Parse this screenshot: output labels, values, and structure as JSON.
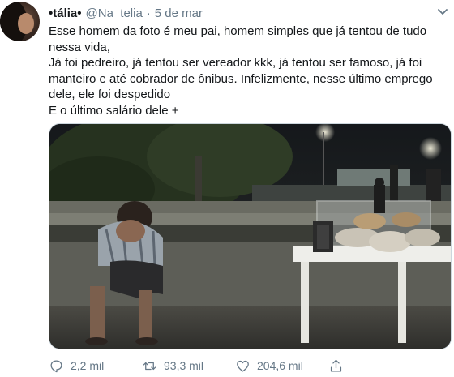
{
  "tweet": {
    "display_name": "•tália•",
    "handle": "@Na_telia",
    "separator": "·",
    "date": "5 de mar",
    "text": "Esse homem da foto é meu pai, homem simples que já tentou de tudo nessa vida,\nJá foi pedreiro, já tentou ser vereador kkk, já tentou ser famoso, já foi manteiro e até cobrador de ônibus. Infelizmente, nesse último emprego dele, ele foi despedido\nE o último salário dele +"
  },
  "actions": {
    "reply_count": "2,2 mil",
    "retweet_count": "93,3 mil",
    "like_count": "204,6 mil"
  },
  "icons": {
    "caret": "chevron-down-icon",
    "reply": "reply-icon",
    "retweet": "retweet-icon",
    "like": "heart-icon",
    "share": "share-icon"
  },
  "colors": {
    "text": "#14171a",
    "secondary": "#657786",
    "border": "#ccd6dd"
  }
}
